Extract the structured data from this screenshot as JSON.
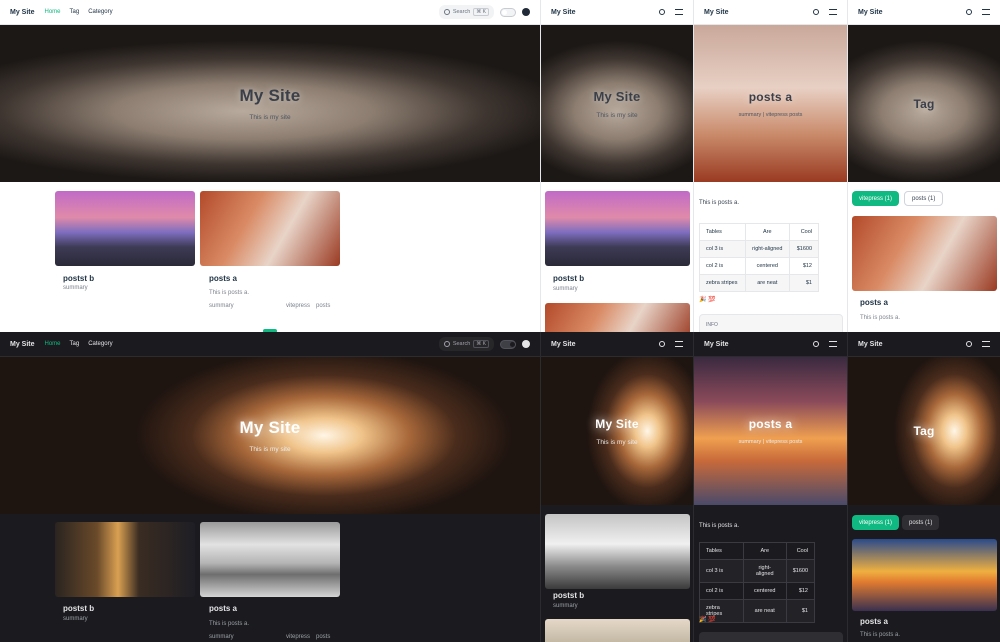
{
  "site": {
    "title": "My Site",
    "subtitle": "This is my site",
    "tag_title": "Tag"
  },
  "nav": {
    "items": [
      "Home",
      "Tag",
      "Category"
    ]
  },
  "search": {
    "label": "Search",
    "shortcut": "⌘ K"
  },
  "posts": [
    {
      "title": "postst b",
      "summary": "summary"
    },
    {
      "title": "posts a",
      "body": "This is posts a.",
      "summary": "summary",
      "tags": [
        "vitepress",
        "posts"
      ]
    }
  ],
  "post_page": {
    "title": "posts a",
    "meta": "summary  |  vitepress  posts",
    "intro": "This is posts a.",
    "info_label": "INFO",
    "emoji": "🎉 💯"
  },
  "table": {
    "headers": [
      "Tables",
      "Are",
      "Cool"
    ],
    "rows": [
      [
        "col 3 is",
        "right-aligned",
        "$1600"
      ],
      [
        "col 2 is",
        "centered",
        "$12"
      ],
      [
        "zebra stripes",
        "are neat",
        "$1"
      ]
    ]
  },
  "tag_filters": [
    {
      "label": "vitepress (1)",
      "active": true
    },
    {
      "label": "posts (1)",
      "active": false
    }
  ],
  "colors": {
    "accent": "#10b981",
    "dark_bg": "#1b1b1f",
    "light_bg": "#ffffff"
  }
}
